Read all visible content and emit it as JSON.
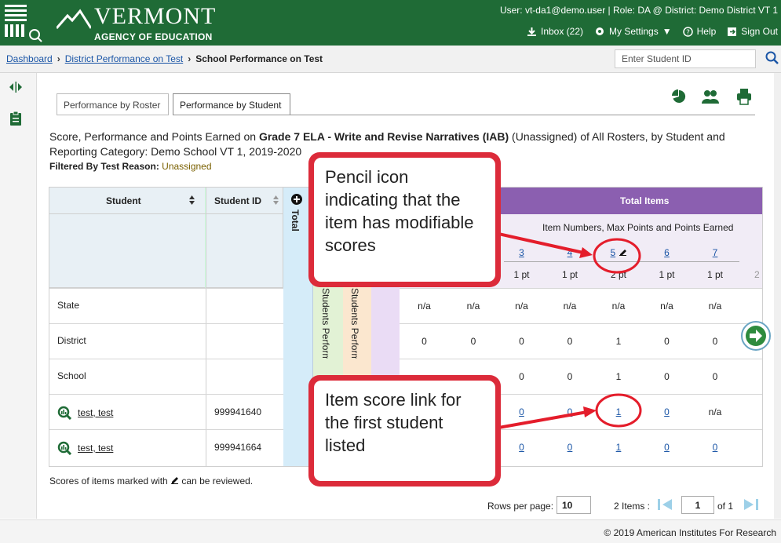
{
  "header": {
    "logo_text": "VERMONT",
    "agency": "AGENCY OF EDUCATION",
    "user_line": "User: vt-da1@demo.user  |  Role: DA @ District: Demo District VT 1",
    "inbox": "Inbox (22)",
    "settings": "My Settings",
    "help": "Help",
    "signout": "Sign Out"
  },
  "breadcrumb": {
    "dashboard": "Dashboard",
    "district": "District Performance on Test",
    "current": "School Performance on Test"
  },
  "search": {
    "placeholder": "Enter Student ID"
  },
  "tabs": [
    {
      "label": "Performance by Roster"
    },
    {
      "label": "Performance by Student"
    }
  ],
  "report": {
    "title_pre": "Score, Performance and Points Earned on ",
    "title_bold": "Grade 7 ELA - Write and Revise Narratives (IAB)",
    "title_post": " (Unassigned) of All Rosters, by Student and Reporting Category: Demo School VT 1, 2019-2020",
    "filter_label": "Filtered By Test Reason:",
    "filter_value": "Unassigned"
  },
  "table": {
    "col_student": "Student",
    "col_student_id": "Student ID",
    "col_total": "Total",
    "col_perf1": "Students Performance",
    "col_perf2": "Students Performance",
    "total_items": "Total Items",
    "item_caption": "Item Numbers, Max Points and Points Earned",
    "items": [
      {
        "num": "3",
        "pts": "1 pt"
      },
      {
        "num": "4",
        "pts": "1 pt"
      },
      {
        "num": "5",
        "pts": "2 pt"
      },
      {
        "num": "6",
        "pts": "1 pt"
      },
      {
        "num": "7",
        "pts": "1 pt"
      }
    ],
    "extra_col_fragment": "2",
    "rows": [
      {
        "name": "State",
        "id": "",
        "values": [
          "n/a",
          "n/a",
          "n/a",
          "n/a",
          "n/a",
          "n/a",
          "n/a"
        ],
        "links": false
      },
      {
        "name": "District",
        "id": "",
        "values": [
          "0",
          "0",
          "0",
          "0",
          "1",
          "0",
          "0"
        ],
        "links": false
      },
      {
        "name": "School",
        "id": "",
        "values": [
          "",
          "",
          "0",
          "0",
          "1",
          "0",
          "0"
        ],
        "links": false
      },
      {
        "name": "test, test",
        "id": "999941640",
        "values": [
          "",
          "",
          "0",
          "0",
          "1",
          "0",
          "n/a"
        ],
        "links": true
      },
      {
        "name": "test, test",
        "id": "999941664",
        "values": [
          "",
          "",
          "0",
          "0",
          "1",
          "0",
          "0"
        ],
        "links": true
      }
    ]
  },
  "note": "Scores of items marked with",
  "note_tail": "can be reviewed.",
  "pager": {
    "rows_label": "Rows per page:",
    "rows_value": "10",
    "items_label": "2 Items :",
    "page_value": "1",
    "of_label": "of 1"
  },
  "callouts": {
    "pencil": "Pencil icon indicating that the item has modifiable scores",
    "link": "Item score link for the first student listed"
  },
  "footer": "© 2019 American Institutes For Research",
  "colors": {
    "header_green": "#1f6b36",
    "total_items_purple": "#8b5fb0",
    "callout_red": "#dc2b3a",
    "link_blue": "#1a55a6"
  }
}
